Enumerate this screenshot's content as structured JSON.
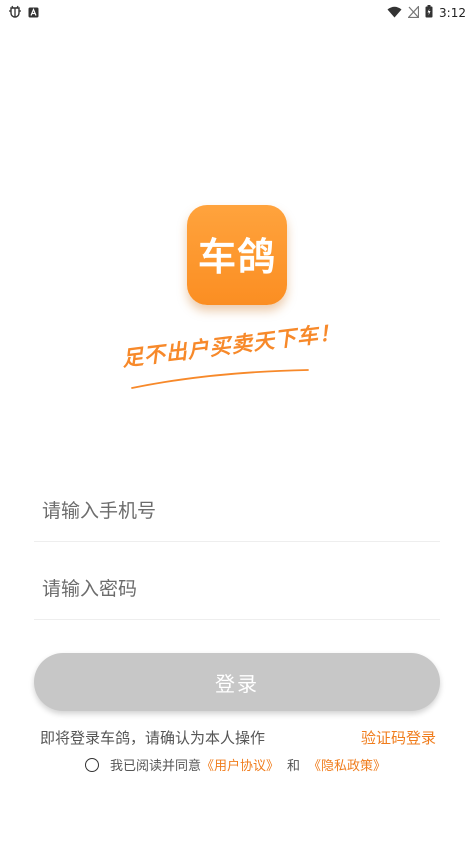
{
  "status_bar": {
    "time": "3:12",
    "left_icons": [
      "bug-notification-icon",
      "accessibility-a-icon"
    ],
    "right_icons": [
      "wifi-icon",
      "no-signal-icon",
      "battery-icon"
    ]
  },
  "logo": {
    "text": "车鸽",
    "bg_color": "#fb8e22"
  },
  "slogan": "足不出户买卖天下车！",
  "form": {
    "phone_placeholder": "请输入手机号",
    "phone_value": "",
    "password_placeholder": "请输入密码",
    "password_value": ""
  },
  "login_button": "登录",
  "hint": "即将登录车鸽，请确认为本人操作",
  "sms_login": "验证码登录",
  "agreement": {
    "prefix": "我已阅读并同意",
    "user_agreement": "《用户协议》",
    "and": "和",
    "privacy_policy": "《隐私政策》"
  },
  "colors": {
    "accent": "#f07d1d",
    "button_disabled": "#c7c7c7"
  }
}
